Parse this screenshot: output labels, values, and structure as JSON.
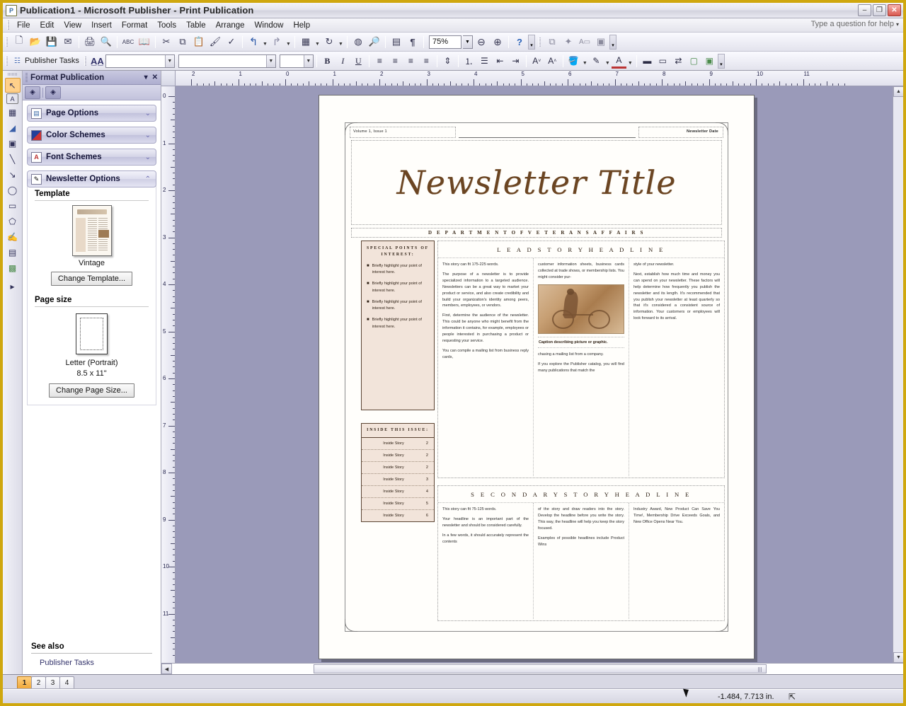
{
  "window": {
    "title": "Publication1 - Microsoft Publisher - Print Publication",
    "app_icon": "publisher-icon",
    "minimize": "–",
    "restore": "❐",
    "close": "✕"
  },
  "menu": {
    "items": [
      "File",
      "Edit",
      "View",
      "Insert",
      "Format",
      "Tools",
      "Table",
      "Arrange",
      "Window",
      "Help"
    ],
    "help_box_placeholder": "Type a question for help"
  },
  "standard_toolbar": {
    "zoom_value": "75%",
    "buttons": [
      {
        "name": "new-icon",
        "glyph": "🗋"
      },
      {
        "name": "open-icon",
        "glyph": "📂"
      },
      {
        "name": "save-icon",
        "glyph": "💾"
      },
      {
        "name": "email-icon",
        "glyph": "✉"
      },
      {
        "name": "print-icon",
        "glyph": "🖨"
      },
      {
        "name": "print-preview-icon",
        "glyph": "🔍"
      },
      {
        "name": "spelling-icon",
        "glyph": "✓"
      },
      {
        "name": "research-icon",
        "glyph": "📖"
      },
      {
        "name": "cut-icon",
        "glyph": "✂"
      },
      {
        "name": "copy-icon",
        "glyph": "⧉"
      },
      {
        "name": "paste-icon",
        "glyph": "📋"
      },
      {
        "name": "format-painter-icon",
        "glyph": "🖌"
      },
      {
        "name": "undo-icon",
        "glyph": "↰"
      },
      {
        "name": "redo-icon",
        "glyph": "↱"
      },
      {
        "name": "insert-object-icon",
        "glyph": "▦"
      },
      {
        "name": "rotate-icon",
        "glyph": "↻"
      },
      {
        "name": "design-checker-icon",
        "glyph": "◍"
      },
      {
        "name": "web-preview-icon",
        "glyph": "🔎"
      },
      {
        "name": "special-characters-icon",
        "glyph": "▤"
      },
      {
        "name": "show-formatting-icon",
        "glyph": "¶"
      },
      {
        "name": "zoom-out-icon",
        "glyph": "⊖"
      },
      {
        "name": "zoom-in-icon",
        "glyph": "⊕"
      },
      {
        "name": "help-icon",
        "glyph": "?"
      },
      {
        "name": "insert-page-icon",
        "glyph": "⧉"
      },
      {
        "name": "design-gallery-icon",
        "glyph": "✦"
      },
      {
        "name": "text-box-connect-icon",
        "glyph": "A▭"
      },
      {
        "name": "picture-frame-icon",
        "glyph": "▣"
      }
    ]
  },
  "formatting_toolbar": {
    "publisher_tasks_label": "Publisher Tasks",
    "style_value": "",
    "font_value": "",
    "size_value": "",
    "buttons": [
      {
        "name": "bold-button",
        "glyph": "B"
      },
      {
        "name": "italic-button",
        "glyph": "I"
      },
      {
        "name": "underline-button",
        "glyph": "U"
      },
      {
        "name": "align-left-button",
        "glyph": "≡"
      },
      {
        "name": "align-center-button",
        "glyph": "≡"
      },
      {
        "name": "align-right-button",
        "glyph": "≡"
      },
      {
        "name": "justify-button",
        "glyph": "≡"
      },
      {
        "name": "line-spacing-button",
        "glyph": "⇕"
      },
      {
        "name": "numbering-button",
        "glyph": "⒈"
      },
      {
        "name": "bullets-button",
        "glyph": "•"
      },
      {
        "name": "decrease-indent-button",
        "glyph": "⇤"
      },
      {
        "name": "increase-indent-button",
        "glyph": "⇥"
      },
      {
        "name": "decrease-font-button",
        "glyph": "A"
      },
      {
        "name": "increase-font-button",
        "glyph": "A"
      },
      {
        "name": "fill-color-button",
        "glyph": "▱"
      },
      {
        "name": "line-color-button",
        "glyph": "✎"
      },
      {
        "name": "font-color-button",
        "glyph": "A"
      },
      {
        "name": "line-style-button",
        "glyph": "▬"
      },
      {
        "name": "dash-style-button",
        "glyph": "▭"
      },
      {
        "name": "arrow-style-button",
        "glyph": "⇄"
      },
      {
        "name": "shadow-style-button",
        "glyph": "▢"
      },
      {
        "name": "3d-style-button",
        "glyph": "▣"
      }
    ]
  },
  "objects_toolbar": {
    "items": [
      {
        "name": "select-objects-tool",
        "glyph": "↖",
        "selected": true
      },
      {
        "name": "text-box-tool",
        "glyph": "A"
      },
      {
        "name": "insert-table-tool",
        "glyph": "▦"
      },
      {
        "name": "wordart-tool",
        "glyph": "◢"
      },
      {
        "name": "picture-frame-tool",
        "glyph": "▣"
      },
      {
        "name": "line-tool",
        "glyph": "╲"
      },
      {
        "name": "arrow-tool",
        "glyph": "↘"
      },
      {
        "name": "oval-tool",
        "glyph": "◯"
      },
      {
        "name": "rectangle-tool",
        "glyph": "▭"
      },
      {
        "name": "autoshapes-tool",
        "glyph": "⬠"
      },
      {
        "name": "hot-spot-tool",
        "glyph": "✋"
      },
      {
        "name": "form-control-tool",
        "glyph": "▤"
      },
      {
        "name": "design-gallery-object-tool",
        "glyph": "▩"
      },
      {
        "name": "toolbar-expand",
        "glyph": "▸"
      }
    ]
  },
  "task_pane": {
    "title": "Format Publication",
    "dropdown_icon": "▾",
    "close_icon": "✕",
    "nav": {
      "back_icon": "◈",
      "forward_icon": "◈"
    },
    "sections": [
      {
        "name": "page-options",
        "label": "Page Options",
        "icon": "📄",
        "chevron": "⌄",
        "expanded": false
      },
      {
        "name": "color-schemes",
        "label": "Color Schemes",
        "icon": "▦",
        "chevron": "⌄",
        "expanded": false
      },
      {
        "name": "font-schemes",
        "label": "Font Schemes",
        "icon": "A",
        "chevron": "⌄",
        "expanded": false
      },
      {
        "name": "newsletter-options",
        "label": "Newsletter Options",
        "icon": "📝",
        "chevron": "⌃",
        "expanded": true
      }
    ],
    "template": {
      "heading": "Template",
      "name": "Vintage",
      "change_button": "Change Template..."
    },
    "page_size": {
      "heading": "Page size",
      "name": "Letter (Portrait)",
      "dimensions": "8.5 x 11\"",
      "change_button": "Change Page Size..."
    },
    "see_also": {
      "heading": "See also",
      "links": [
        "Publisher Tasks"
      ]
    }
  },
  "rulers": {
    "horizontal_ticks": [
      "2",
      "1",
      "0",
      "1",
      "2",
      "3",
      "4",
      "5",
      "6",
      "7",
      "8",
      "9",
      "10",
      "11"
    ],
    "vertical_ticks": [
      "0",
      "1",
      "2",
      "3",
      "4",
      "5",
      "6",
      "7",
      "8",
      "9",
      "10",
      "11"
    ]
  },
  "document": {
    "volume_issue": "Volume 1, Issue 1",
    "newsletter_date": "Newsletter Date",
    "title": "Newsletter Title",
    "department": "D E P A R T M E N T   O F   V E T E R A N S   A F F A I R S",
    "special_points": {
      "heading": "SPECIAL POINTS OF INTEREST:",
      "bullets": [
        "Briefly highlight your point of interest here.",
        "Briefly highlight your point of interest here.",
        "Briefly highlight your point of interest here.",
        "Briefly highlight your point of interest here."
      ]
    },
    "inside_this_issue": {
      "heading": "INSIDE THIS ISSUE:",
      "rows": [
        {
          "title": "Inside Story",
          "page": "2"
        },
        {
          "title": "Inside Story",
          "page": "2"
        },
        {
          "title": "Inside Story",
          "page": "2"
        },
        {
          "title": "Inside Story",
          "page": "3"
        },
        {
          "title": "Inside Story",
          "page": "4"
        },
        {
          "title": "Inside Story",
          "page": "5"
        },
        {
          "title": "Inside Story",
          "page": "6"
        }
      ]
    },
    "lead_story": {
      "headline": "L E A D   S T O R Y   H E A D L I N E",
      "col1": [
        "This story can fit 175-225 words.",
        "The purpose of a newsletter is to provide specialized information to a targeted audience. Newsletters can be a great way to market your product or service, and also create credibility and build your organization's identity among peers, members, employees, or vendors.",
        "First, determine the audience of the newsletter. This could be anyone who might benefit from the information it contains, for example, employees or people interested in purchasing a product or requesting your service.",
        "You can compile a mailing list from business reply cards,"
      ],
      "col2_top": "customer information sheets, business cards collected at trade shows, or membership lists. You might consider pur-",
      "caption": "Caption describing picture or graphic.",
      "col2_bottom": [
        "chasing a mailing list from a company.",
        "If you explore the Publisher catalog, you will find many publications that match the"
      ],
      "col3": [
        "style of your newsletter.",
        "Next, establish how much time and money you can spend on your newsletter. These factors will help determine how frequently you publish the newsletter and its length. It's recommended that you publish your newsletter at least quarterly so that it's considered a consistent source of information. Your customers or employees will look forward to its arrival."
      ]
    },
    "secondary_story": {
      "headline": "S E C O N D A R Y   S T O R Y   H E A D L I N E",
      "col1": [
        "This story can fit 75-125 words.",
        "Your headline is an important part of the newsletter and should be considered carefully.",
        "In a few words, it should accurately represent the contents"
      ],
      "col2": [
        "of the story and draw readers into the story. Develop the headline before you write the story. This way, the headline will help you keep the story focused.",
        "Examples of possible headlines include Product Wins"
      ],
      "col3": [
        "Industry Award, New Product Can Save You Time!, Membership Drive Exceeds Goals, and New Office Opens Near You."
      ]
    }
  },
  "page_tabs": {
    "pages": [
      "1",
      "2",
      "3",
      "4"
    ],
    "selected": "1"
  },
  "status_bar": {
    "coordinates": "-1.484, 7.713 in.",
    "object_size_icon": "object-position-icon"
  },
  "colors": {
    "window_frame": "#cfa70e",
    "canvas_background": "#9a9ab9",
    "accent_brown": "#6b4522",
    "sidebar_fill": "#f2e4da",
    "selected_tab": "#f0a93b"
  }
}
